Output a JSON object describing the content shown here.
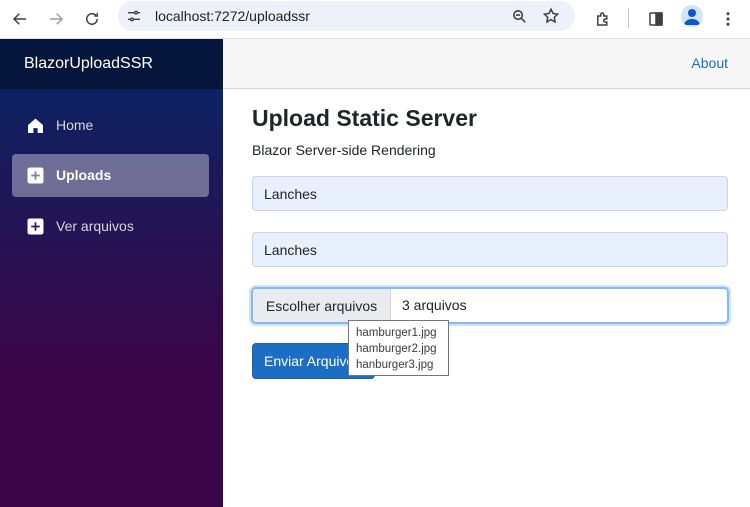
{
  "browser": {
    "url": "localhost:7272/uploadssr"
  },
  "sidebar": {
    "brand": "BlazorUploadSSR",
    "items": [
      {
        "label": "Home",
        "icon": "home-icon",
        "active": false
      },
      {
        "label": "Uploads",
        "icon": "plus-square-icon",
        "active": true
      },
      {
        "label": "Ver arquivos",
        "icon": "plus-square-icon",
        "active": false
      }
    ]
  },
  "topbar": {
    "about": "About"
  },
  "main": {
    "title": "Upload Static Server",
    "subtitle": "Blazor Server-side Rendering",
    "input1_value": "Lanches",
    "input2_value": "Lanches",
    "file_button": "Escolher arquivos",
    "file_status": "3 arquivos",
    "submit": "Enviar Arquivos",
    "tooltip_files": [
      "hamburger1.jpg",
      "hamburger2.jpg",
      "hanburger3.jpg"
    ]
  },
  "colors": {
    "accent": "#1b6ec2",
    "sidebar_top": "#052767",
    "sidebar_bottom": "#3a0647"
  }
}
